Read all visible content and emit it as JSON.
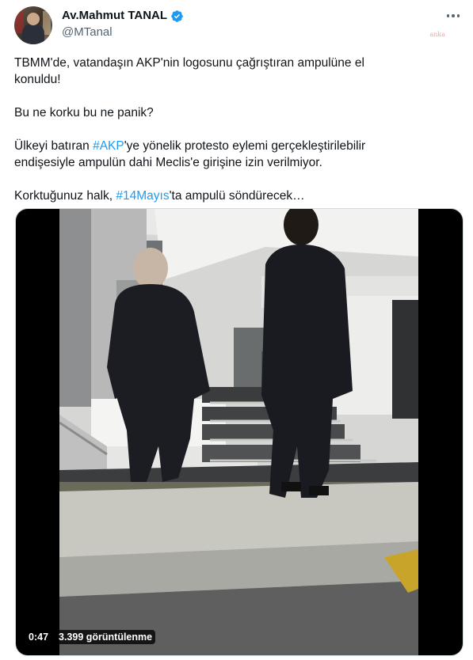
{
  "author": {
    "display_name": "Av.Mahmut TANAL",
    "handle": "@MTanal",
    "avatar_icon": "profile-photo",
    "verified_icon": "verified-badge-icon",
    "verified_color": "#1d9bf0"
  },
  "watermark": "anka",
  "tweet": {
    "line1": "TBMM'de, vatandaşın AKP'nin logosunu çağrıştıran ampulüne el",
    "line2": "konuldu!",
    "line3": "Bu ne korku bu ne panik?",
    "line4_pre": "Ülkeyi batıran ",
    "line4_tag": "#AKP",
    "line4_post": "'ye yönelik protesto eylemi gerçekleştirilebilir",
    "line5": "endişesiyle ampulün dahi Meclis'e girişine izin verilmiyor.",
    "line6_pre": "Korktuğunuz halk, ",
    "line6_tag": "#14Mayıs",
    "line6_post": "'ta ampulü söndürecek…",
    "hashtag_color": "#1d9bf0"
  },
  "video": {
    "duration": "0:47",
    "views": "3.399 görüntülenme"
  }
}
